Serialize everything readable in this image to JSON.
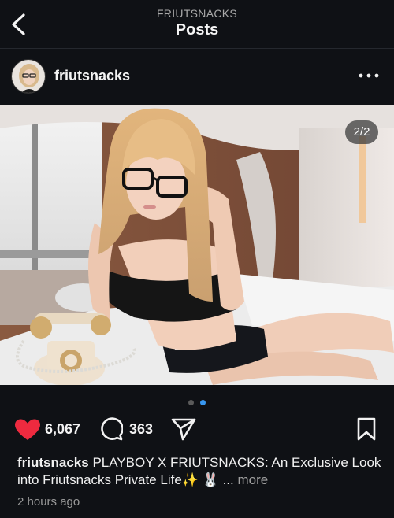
{
  "nav": {
    "account_label": "FRIUTSNACKS",
    "title": "Posts"
  },
  "post": {
    "username": "friutsnacks",
    "image_counter": "2/2",
    "carousel": {
      "count": 2,
      "active_index": 1
    },
    "likes": "6,067",
    "comments": "363",
    "caption_user": "friutsnacks",
    "caption_text": "PLAYBOY X FRIUTSNACKS: An Exclusive Look into Friutsnacks Private Life✨ 🐰 ...",
    "more_label": "more",
    "timestamp": "2 hours ago"
  },
  "colors": {
    "background": "#0f1115",
    "like_red": "#ee2a3f",
    "dot_active": "#3897f0",
    "dot_inactive": "#5a5a5a"
  },
  "icons": [
    "back-chevron-icon",
    "more-dots-icon",
    "heart-filled-icon",
    "comment-bubble-icon",
    "share-paper-plane-icon",
    "bookmark-icon"
  ]
}
